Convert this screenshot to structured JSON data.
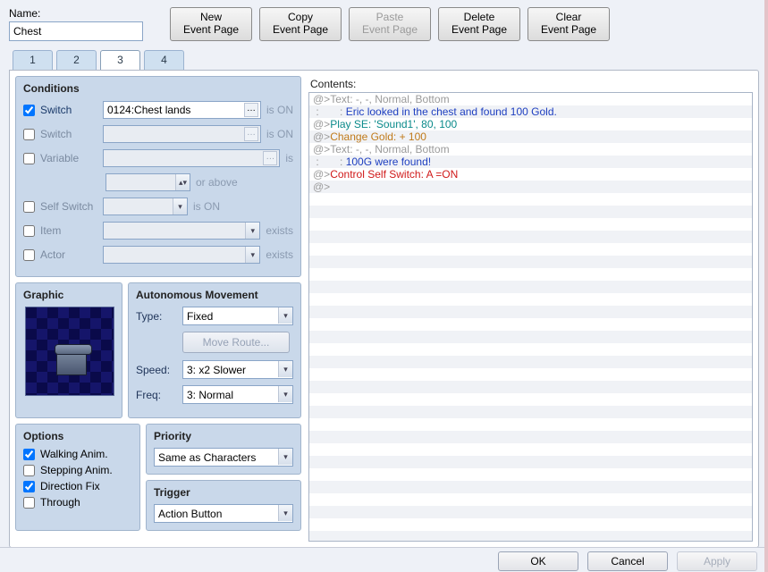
{
  "name": {
    "label": "Name:",
    "value": "Chest"
  },
  "buttons": {
    "new1": "New",
    "new2": "Event Page",
    "copy1": "Copy",
    "copy2": "Event Page",
    "paste1": "Paste",
    "paste2": "Event Page",
    "delete1": "Delete",
    "delete2": "Event Page",
    "clear1": "Clear",
    "clear2": "Event Page"
  },
  "tabs": [
    "1",
    "2",
    "3",
    "4"
  ],
  "conditions": {
    "title": "Conditions",
    "switch1": {
      "label": "Switch",
      "value": "0124:Chest lands",
      "tail": "is ON",
      "checked": true
    },
    "switch2": {
      "label": "Switch",
      "tail": "is ON"
    },
    "variable": {
      "label": "Variable",
      "tail": "is",
      "tail2": "or above"
    },
    "selfswitch": {
      "label": "Self Switch",
      "tail": "is ON"
    },
    "item": {
      "label": "Item",
      "tail": "exists"
    },
    "actor": {
      "label": "Actor",
      "tail": "exists"
    }
  },
  "graphic": {
    "title": "Graphic"
  },
  "autonomous": {
    "title": "Autonomous Movement",
    "type_label": "Type:",
    "type": "Fixed",
    "move_route": "Move Route...",
    "speed_label": "Speed:",
    "speed": "3: x2 Slower",
    "freq_label": "Freq:",
    "freq": "3: Normal"
  },
  "options": {
    "title": "Options",
    "walking": {
      "label": "Walking Anim.",
      "checked": true
    },
    "stepping": {
      "label": "Stepping Anim.",
      "checked": false
    },
    "direction": {
      "label": "Direction Fix",
      "checked": true
    },
    "through": {
      "label": "Through",
      "checked": false
    }
  },
  "priority": {
    "title": "Priority",
    "value": "Same as Characters"
  },
  "trigger": {
    "title": "Trigger",
    "value": "Action Button"
  },
  "contents": {
    "title": "Contents:",
    "lines": [
      {
        "pre": "@>",
        "text": "Text: -, -, Normal, Bottom",
        "cls": "c-gray"
      },
      {
        "pre": " :       : ",
        "text": "Eric looked in the chest and found 100 Gold.",
        "cls": "c-blue"
      },
      {
        "pre": "@>",
        "text": "Play SE: 'Sound1', 80, 100",
        "cls": "c-teal"
      },
      {
        "pre": "@>",
        "text": "Change Gold: + 100",
        "cls": "c-orange"
      },
      {
        "pre": "@>",
        "text": "Text: -, -, Normal, Bottom",
        "cls": "c-gray"
      },
      {
        "pre": " :       : ",
        "text": "100G were found!",
        "cls": "c-blue"
      },
      {
        "pre": "@>",
        "text": "Control Self Switch: A =ON",
        "cls": "c-red"
      },
      {
        "pre": "@>",
        "text": "",
        "cls": ""
      }
    ]
  },
  "footer": {
    "ok": "OK",
    "cancel": "Cancel",
    "apply": "Apply"
  }
}
